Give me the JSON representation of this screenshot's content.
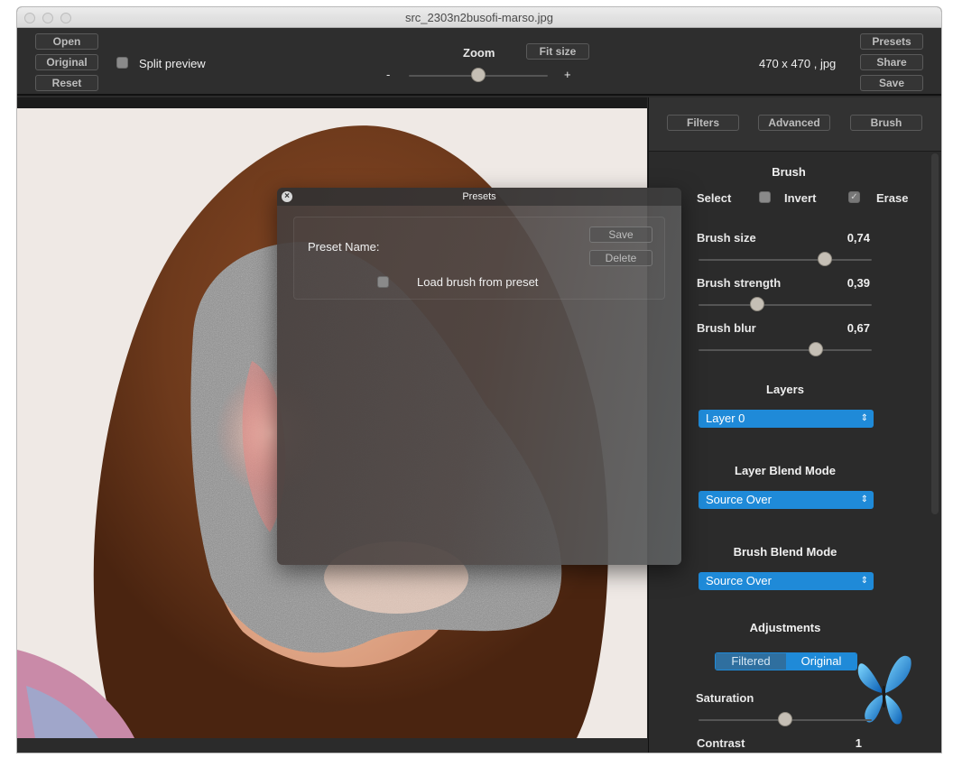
{
  "window": {
    "title": "src_2303n2busofi-marso.jpg"
  },
  "toolbar": {
    "open": "Open",
    "original": "Original",
    "reset": "Reset",
    "split_preview": "Split preview",
    "zoom_label": "Zoom",
    "fit_size": "Fit size",
    "zoom_minus": "-",
    "zoom_plus": "+",
    "zoom_level": 0.5,
    "image_info": "470 x 470 , jpg",
    "presets": "Presets",
    "share": "Share",
    "save": "Save"
  },
  "tabs": {
    "filters": "Filters",
    "advanced": "Advanced",
    "brush": "Brush"
  },
  "brush": {
    "title": "Brush",
    "select": "Select",
    "invert": "Invert",
    "erase": "Erase",
    "invert_checked": false,
    "erase_checked": true,
    "size_label": "Brush size",
    "size_value": "0,74",
    "strength_label": "Brush strength",
    "strength_value": "0,39",
    "blur_label": "Brush blur",
    "blur_value": "0,67"
  },
  "layers": {
    "title": "Layers",
    "selected": "Layer 0"
  },
  "layer_blend": {
    "title": "Layer Blend Mode",
    "selected": "Source Over"
  },
  "brush_blend": {
    "title": "Brush Blend Mode",
    "selected": "Source Over"
  },
  "adjustments": {
    "title": "Adjustments",
    "filtered": "Filtered",
    "original": "Original",
    "saturation_label": "Saturation",
    "saturation_level": 0.5,
    "contrast_label": "Contrast",
    "contrast_value": "1"
  },
  "presets_dialog": {
    "title": "Presets",
    "preset_name_label": "Preset Name:",
    "save": "Save",
    "delete": "Delete",
    "load_brush": "Load brush from preset"
  },
  "colors": {
    "accent": "#1f8ad8",
    "panel": "#2b2b2b"
  },
  "icons": {
    "close": "close-icon",
    "butterfly": "butterfly-icon"
  }
}
